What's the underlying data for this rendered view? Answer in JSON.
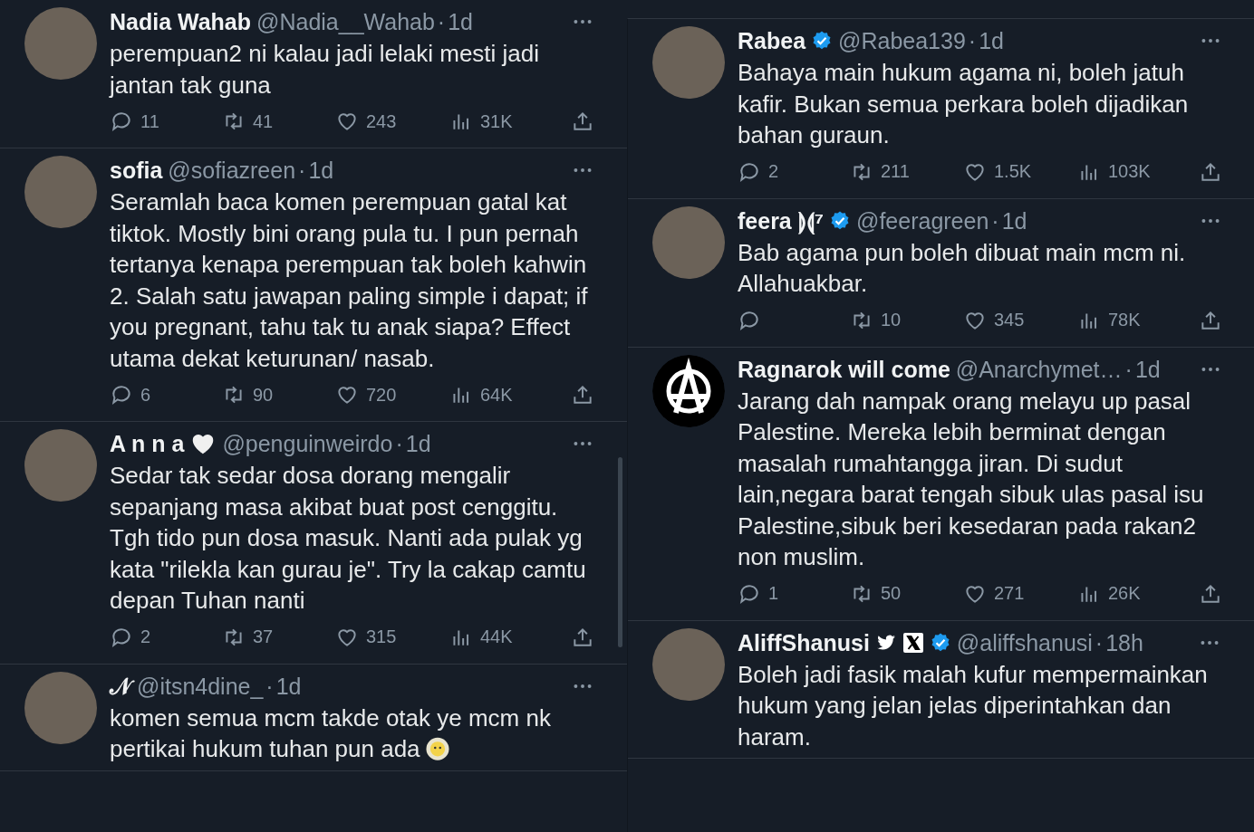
{
  "columns": [
    {
      "tweets": [
        {
          "avatar": {
            "kind": "photo"
          },
          "name": "Nadia Wahab",
          "handle": "@Nadia__Wahab",
          "separator": "·",
          "time": "1d",
          "text": "perempuan2 ni kalau jadi lelaki mesti jadi jantan tak guna",
          "replies": "11",
          "retweets": "41",
          "likes": "243",
          "views": "31K"
        },
        {
          "avatar": {
            "kind": "photo"
          },
          "name": "sofia",
          "handle": "@sofiazreen",
          "separator": "·",
          "time": "1d",
          "text": "Seramlah baca komen perempuan gatal kat tiktok. Mostly bini orang pula tu. I pun pernah tertanya kenapa perempuan tak boleh kahwin 2. Salah satu jawapan paling simple i dapat; if you pregnant, tahu tak tu anak siapa? Effect utama dekat keturunan/ nasab.",
          "replies": "6",
          "retweets": "90",
          "likes": "720",
          "views": "64K"
        },
        {
          "avatar": {
            "kind": "photo"
          },
          "name": "A n n a",
          "badges": [
            {
              "kind": "heart"
            }
          ],
          "handle": "@penguinweirdo",
          "separator": "·",
          "time": "1d",
          "text": "Sedar tak sedar dosa dorang mengalir sepanjang masa akibat buat post cenggitu. Tgh tido pun dosa masuk. Nanti ada pulak yg kata \"rilekla kan gurau je\". Try la cakap camtu depan Tuhan nanti",
          "replies": "2",
          "retweets": "37",
          "likes": "315",
          "views": "44K"
        },
        {
          "avatar": {
            "kind": "photo"
          },
          "name": "𝒩",
          "handle": "@itsn4dine_",
          "separator": "·",
          "time": "1d",
          "text": "komen semua mcm takde otak ye mcm nk pertikai hukum tuhan pun ada",
          "trailing_icon": {
            "kind": "face-in-clouds"
          }
        }
      ]
    },
    {
      "tweets": [
        {
          "avatar": {
            "kind": "photo"
          },
          "name": "Rabea",
          "badges": [
            {
              "kind": "verified"
            }
          ],
          "handle": "@Rabea139",
          "separator": "·",
          "time": "1d",
          "text": "Bahaya main hukum agama ni, boleh jatuh kafir. Bukan semua perkara boleh dijadikan bahan guraun.",
          "replies": "2",
          "retweets": "211",
          "likes": "1.5K",
          "views": "103K"
        },
        {
          "avatar": {
            "kind": "photo"
          },
          "name": "feera ⟭⟬⁷",
          "badges": [
            {
              "kind": "verified"
            }
          ],
          "handle": "@feeragreen",
          "separator": "·",
          "time": "1d",
          "text": "Bab agama pun boleh dibuat main mcm ni. Allahuakbar.",
          "retweets": "10",
          "likes": "345",
          "views": "78K"
        },
        {
          "avatar": {
            "kind": "anarchy"
          },
          "name": "Ragnarok will come",
          "handle": "@Anarchymet…",
          "separator": "·",
          "time": "1d",
          "text": "Jarang dah nampak orang melayu up pasal Palestine. Mereka lebih berminat dengan masalah rumahtangga jiran. Di sudut lain,negara barat tengah sibuk ulas pasal isu Palestine,sibuk beri kesedaran pada rakan2 non muslim.",
          "replies": "1",
          "retweets": "50",
          "likes": "271",
          "views": "26K"
        },
        {
          "avatar": {
            "kind": "photo"
          },
          "name": "AliffShanusi",
          "badges": [
            {
              "kind": "bird"
            },
            {
              "kind": "x"
            },
            {
              "kind": "verified"
            }
          ],
          "handle": "@aliffshanusi",
          "separator": "·",
          "time": "18h",
          "text": "Boleh jadi fasik malah kufur mempermainkan hukum yang jelan jelas diperintahkan dan haram."
        }
      ]
    }
  ]
}
